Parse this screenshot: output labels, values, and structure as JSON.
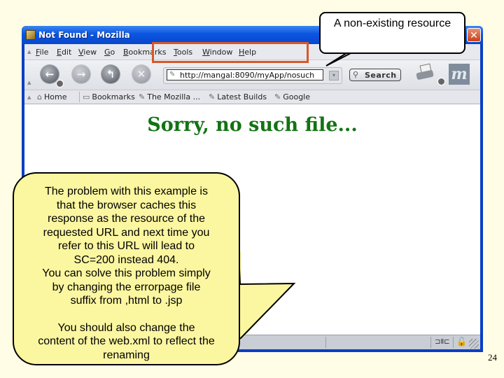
{
  "window": {
    "title": "Not Found - Mozilla",
    "close_glyph": "✕"
  },
  "menubar": {
    "items": [
      "File",
      "Edit",
      "View",
      "Go",
      "Bookmarks",
      "Tools",
      "Window",
      "Help"
    ]
  },
  "navbar": {
    "back_glyph": "←",
    "forward_glyph": "→",
    "reload_glyph": "↰",
    "stop_glyph": "✕",
    "url_icon": "✎",
    "url": "http://mangal:8090/myApp/nosuch",
    "url_dropdown_glyph": "▾",
    "search_icon": "🔍",
    "search_label": "Search",
    "logo_letter": "m"
  },
  "bookmarks": {
    "home_icon": "⌂",
    "home_label": "Home",
    "bookmarks_icon": "▭",
    "bookmarks_label": "Bookmarks",
    "link_icon": "✎",
    "links": [
      "The Mozilla ...",
      "Latest Builds",
      "Google"
    ]
  },
  "page": {
    "heading": "Sorry, no such file...",
    "heading_color": "#137313"
  },
  "statusbar": {
    "connection_icon": "⊐Ⅱ⊏",
    "lock_icon": "🔓"
  },
  "callouts": {
    "top": "A non-existing resource",
    "big_lines": [
      "The problem with this example is",
      "that the browser caches this",
      "response as the resource of the",
      "requested URL and next time you",
      "refer to this URL will lead to",
      "SC=200 instead 404.",
      "You can solve this problem simply",
      "by changing the errorpage file",
      "suffix from ,html to .jsp"
    ],
    "big_lines_2": [
      "You should also change the",
      "content of the web.xml to reflect the",
      "renaming"
    ]
  },
  "slide": {
    "page_number": "24"
  }
}
